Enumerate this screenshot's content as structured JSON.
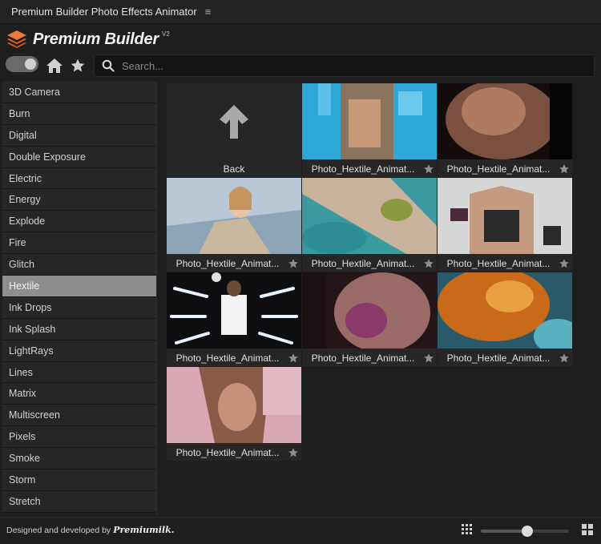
{
  "window": {
    "title": "Premium Builder Photo Effects Animator",
    "menu_icon": "hamburger-icon"
  },
  "brand": {
    "name": "Premium Builder",
    "version": "V2",
    "logo_icon": "stacked-layers-icon",
    "logo_color": "#e8682a"
  },
  "toolbar": {
    "toggle_on": true,
    "home_icon": "home-icon",
    "favorites_icon": "star-icon",
    "search": {
      "placeholder": "Search...",
      "value": "",
      "icon": "search-icon"
    }
  },
  "sidebar": {
    "selected": "Hextile",
    "items": [
      "3D Camera",
      "Burn",
      "Digital",
      "Double Exposure",
      "Electric",
      "Energy",
      "Explode",
      "Fire",
      "Glitch",
      "Hextile",
      "Ink Drops",
      "Ink Splash",
      "LightRays",
      "Lines",
      "Matrix",
      "Multiscreen",
      "Pixels",
      "Smoke",
      "Storm",
      "Stretch"
    ]
  },
  "grid": {
    "back_label": "Back",
    "back_icon": "arrow-up-icon",
    "items": [
      {
        "label": "Photo_Hextile_Animat...",
        "favorite": false
      },
      {
        "label": "Photo_Hextile_Animat...",
        "favorite": false
      },
      {
        "label": "Photo_Hextile_Animat...",
        "favorite": false
      },
      {
        "label": "Photo_Hextile_Animat...",
        "favorite": false
      },
      {
        "label": "Photo_Hextile_Animat...",
        "favorite": false
      },
      {
        "label": "Photo_Hextile_Animat...",
        "favorite": false
      },
      {
        "label": "Photo_Hextile_Animat...",
        "favorite": false
      },
      {
        "label": "Photo_Hextile_Animat...",
        "favorite": false
      },
      {
        "label": "Photo_Hextile_Animat...",
        "favorite": false
      }
    ]
  },
  "footer": {
    "credit": "Designed and developed by",
    "credit_logo": "Premiumilk.",
    "small_grid_icon": "small-grid-icon",
    "large_grid_icon": "large-grid-icon",
    "thumbnail_size": 0.53
  }
}
